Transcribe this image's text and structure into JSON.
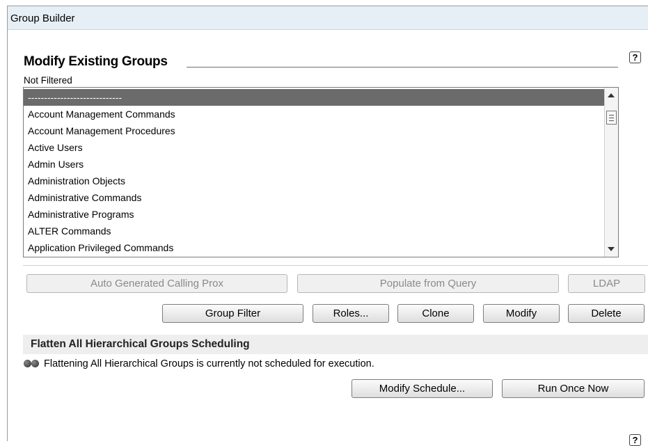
{
  "window": {
    "title": "Group Builder"
  },
  "section": {
    "title": "Modify Existing Groups",
    "filter_status": "Not Filtered",
    "help_icon": "?"
  },
  "group_list": {
    "items": [
      "-----------------------------",
      "Account Management Commands",
      "Account Management Procedures",
      "Active Users",
      "Admin Users",
      "Administration Objects",
      "Administrative Commands",
      "Administrative Programs",
      "ALTER Commands",
      "Application Privileged Commands"
    ],
    "selected_index": 0
  },
  "buttons": {
    "auto_generated": "Auto Generated Calling Prox",
    "populate_query": "Populate from Query",
    "ldap": "LDAP",
    "group_filter": "Group Filter",
    "roles": "Roles...",
    "clone": "Clone",
    "modify": "Modify",
    "delete": "Delete"
  },
  "scheduling": {
    "header": "Flatten All Hierarchical Groups Scheduling",
    "status": "Flattening All Hierarchical Groups is currently not scheduled for execution.",
    "modify_schedule": "Modify Schedule...",
    "run_once": "Run Once Now",
    "status_icon": "status-dots-icon"
  }
}
